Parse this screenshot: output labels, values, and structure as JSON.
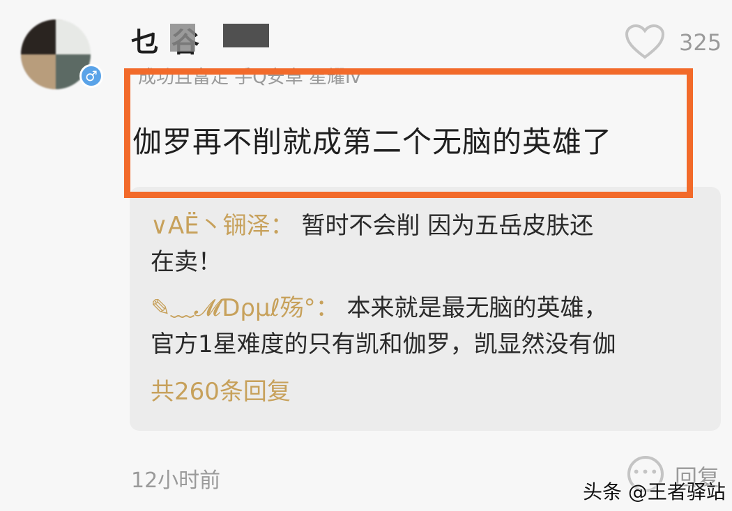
{
  "comment": {
    "username_visible": "乜   谷",
    "user_tags": "成功且富足 手Q安卓 星耀Ⅳ",
    "like_count": "325",
    "text": "伽罗再不削就成第二个无脑的英雄了",
    "time": "12小时前",
    "reply_label": "回复"
  },
  "replies": {
    "items": [
      {
        "name": "∨AË丶锎泽：",
        "text_line1": "暂时不会削 因为五岳皮肤还",
        "text_line2": "在卖！"
      },
      {
        "name": "✎﹏𝓜Ɗρμℓ殇°：",
        "text_line1": "本来就是最无脑的英雄，",
        "text_line2": "官方1星难度的只有凯和伽罗，凯显然没有伽"
      }
    ],
    "more_label": "共260条回复"
  },
  "watermark": "头条 @王者驿站",
  "colors": {
    "highlight": "#f26a2a",
    "reply_name": "#c7a15b",
    "gender": "#5aa3e8"
  },
  "icons": {
    "like": "heart-outline-icon",
    "reply": "chat-bubble-icon",
    "gender": "male-icon"
  }
}
